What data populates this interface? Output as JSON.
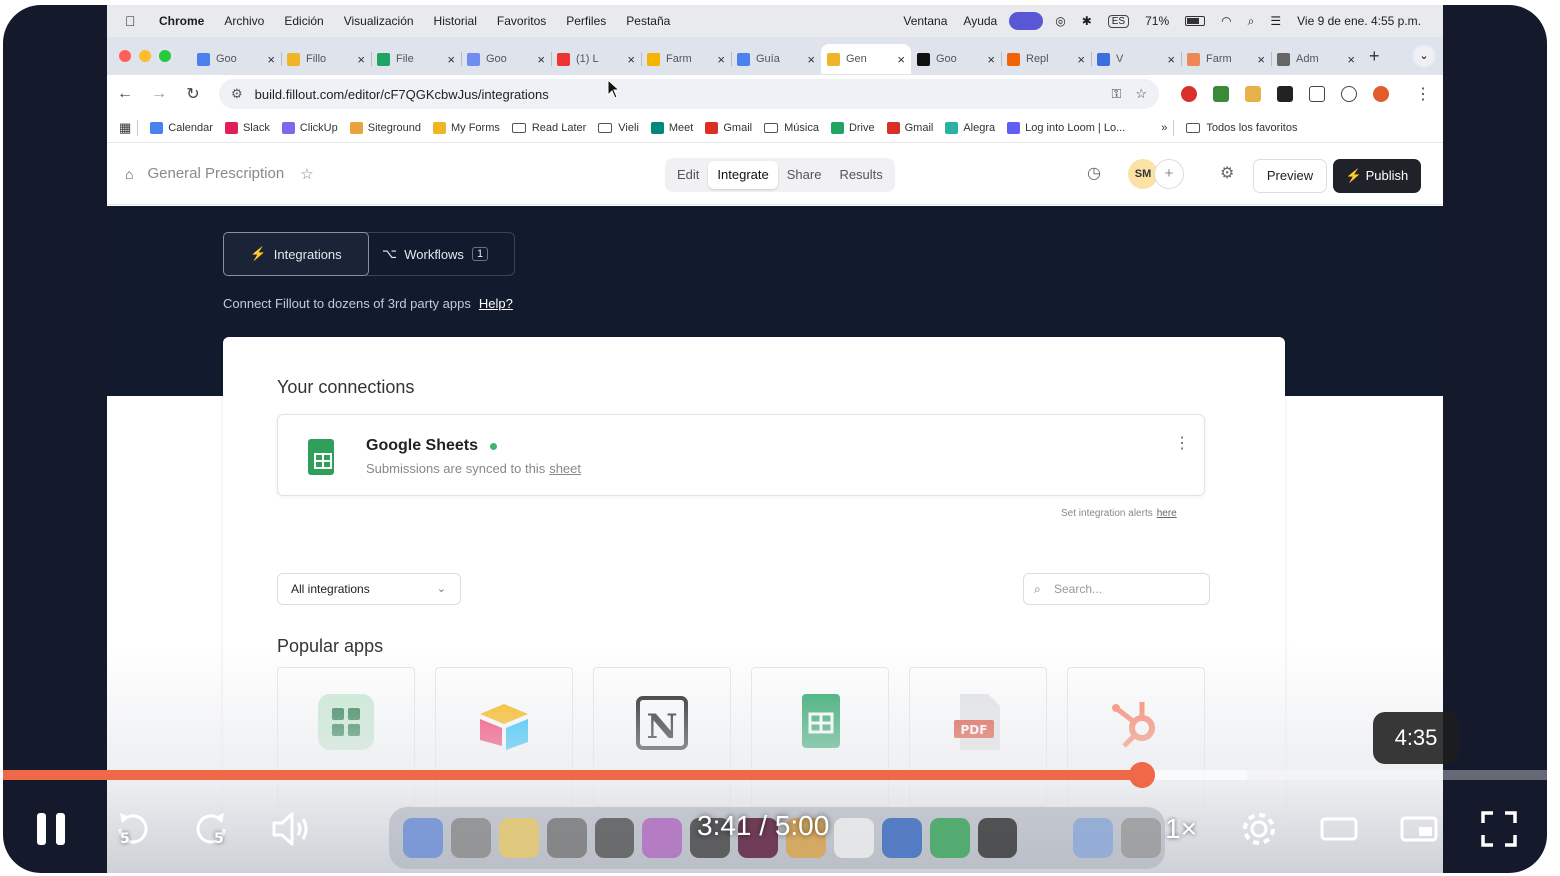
{
  "menubar": {
    "app": "Chrome",
    "items": [
      "Archivo",
      "Edición",
      "Visualización",
      "Historial",
      "Favoritos",
      "Perfiles",
      "Pestaña"
    ],
    "right": {
      "ventana": "Ventana",
      "ayuda": "Ayuda",
      "input": "ES",
      "battery": "71%",
      "datetime": "Vie 9 de ene.  4:55 p.m."
    }
  },
  "tabs": [
    {
      "label": "Goo",
      "color": "#4a80f0"
    },
    {
      "label": "Fillo",
      "color": "#f0b429"
    },
    {
      "label": "File",
      "color": "#1fa463"
    },
    {
      "label": "Goo",
      "color": "#6f8df0"
    },
    {
      "label": "(1) L",
      "color": "#e33"
    },
    {
      "label": "Farm",
      "color": "#f4b400"
    },
    {
      "label": "Guía",
      "color": "#4a80f0"
    },
    {
      "label": "Gen",
      "color": "#f0b429",
      "active": true
    },
    {
      "label": "Goo",
      "color": "#111"
    },
    {
      "label": "Repl",
      "color": "#f26207"
    },
    {
      "label": "V",
      "color": "#3b6fe0"
    },
    {
      "label": "Farm",
      "color": "#e85"
    },
    {
      "label": "Adm",
      "color": "#666"
    }
  ],
  "address": {
    "url": "build.fillout.com/editor/cF7QGKcbwJus/integrations"
  },
  "bookmarks": [
    {
      "label": "Calendar",
      "color": "#4a80f0"
    },
    {
      "label": "Slack",
      "color": "#e01e5a"
    },
    {
      "label": "ClickUp",
      "color": "#7b68ee"
    },
    {
      "label": "Siteground",
      "color": "#e8a33c"
    },
    {
      "label": "My Forms",
      "color": "#f0b429"
    },
    {
      "label": "Read Later",
      "folder": true
    },
    {
      "label": "Vieli",
      "folder": true
    },
    {
      "label": "Meet",
      "color": "#00897b"
    },
    {
      "label": "Gmail",
      "color": "#d93025"
    },
    {
      "label": "Música",
      "folder": true
    },
    {
      "label": "Drive",
      "color": "#1fa463"
    },
    {
      "label": "Gmail",
      "color": "#d93025"
    },
    {
      "label": "Alegra",
      "color": "#2bb3a0"
    },
    {
      "label": "Log into Loom | Lo...",
      "color": "#625df5"
    }
  ],
  "bookmarks_more": "»",
  "bookmarks_all": "Todos los favoritos",
  "app": {
    "form_name": "General Prescription",
    "modes": [
      "Edit",
      "Integrate",
      "Share",
      "Results"
    ],
    "avatar": "SM",
    "preview": "Preview",
    "publish": "Publish"
  },
  "hero": {
    "tab_integrations": "Integrations",
    "tab_workflows": "Workflows",
    "workflows_count": "1",
    "description": "Connect Fillout to dozens of 3rd party apps",
    "help": "Help?"
  },
  "connections": {
    "title": "Your connections",
    "item_name": "Google Sheets",
    "item_sub": "Submissions are synced to this",
    "item_link": "sheet",
    "alerts_text": "Set integration alerts",
    "alerts_link": "here"
  },
  "filter": {
    "value": "All integrations",
    "search_placeholder": "Search..."
  },
  "popular": {
    "title": "Popular apps"
  },
  "player": {
    "time": "3:41 / 5:00",
    "tooltip": "4:35",
    "speed": "1×",
    "progress_fraction": 0.738,
    "buffered_fraction": 0.806
  }
}
